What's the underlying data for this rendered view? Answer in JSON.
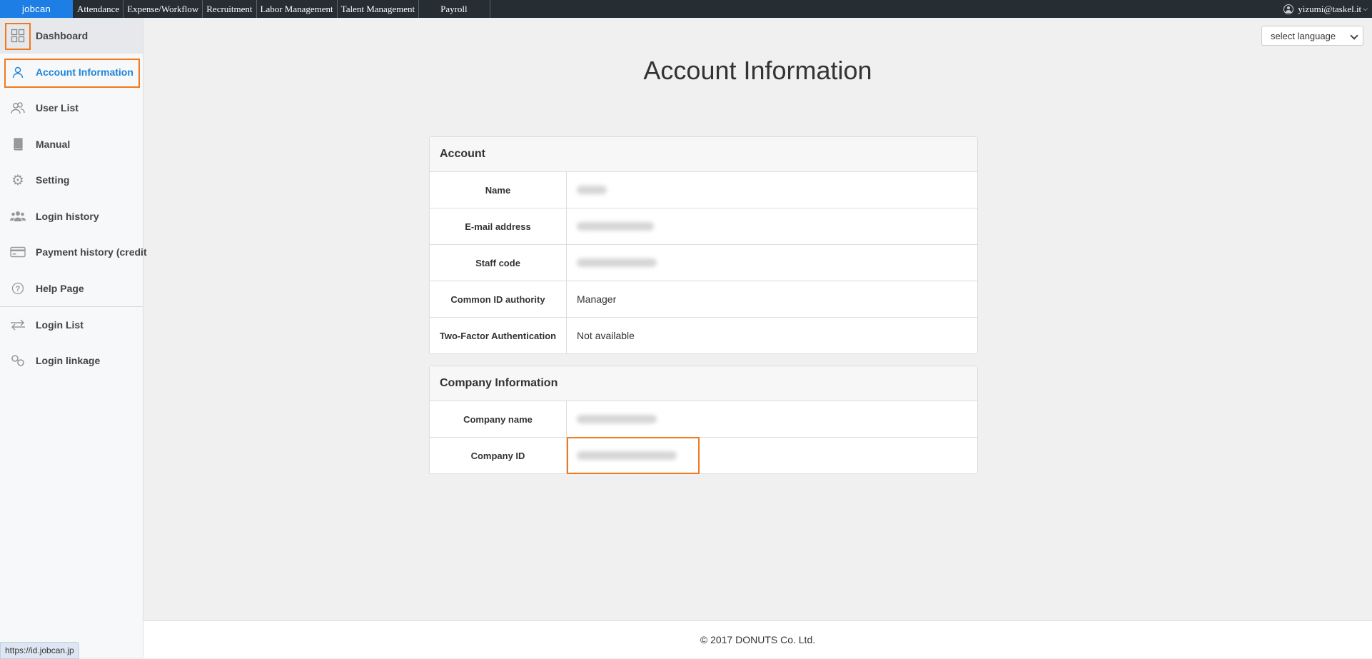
{
  "topbar": {
    "logo": "jobcan",
    "nav": [
      "Attendance",
      "Expense/Workflow",
      "Recruitment",
      "Labor Management",
      "Talent Management",
      "Payroll"
    ],
    "user_email": "yizumi@taskel.it"
  },
  "sidebar": {
    "items": [
      {
        "label": "Dashboard",
        "icon": "grid-icon"
      },
      {
        "label": "Account Information",
        "icon": "user-icon"
      },
      {
        "label": "User List",
        "icon": "users-icon"
      },
      {
        "label": "Manual",
        "icon": "book-icon"
      },
      {
        "label": "Setting",
        "icon": "gear-icon"
      },
      {
        "label": "Login history",
        "icon": "group-icon"
      },
      {
        "label": "Payment history (credit",
        "icon": "credit-card-icon"
      },
      {
        "label": "Help Page",
        "icon": "help-icon"
      },
      {
        "label": "Login List",
        "icon": "swap-icon"
      },
      {
        "label": "Login linkage",
        "icon": "link-icon"
      }
    ],
    "active_item": "Account Information"
  },
  "language_select": {
    "value": "select language"
  },
  "page": {
    "title": "Account Information"
  },
  "account_panel": {
    "title": "Account",
    "rows": [
      {
        "label": "Name",
        "value": ""
      },
      {
        "label": "E-mail address",
        "value": ""
      },
      {
        "label": "Staff code",
        "value": ""
      },
      {
        "label": "Common ID authority",
        "value": "Manager"
      },
      {
        "label": "Two-Factor Authentication",
        "value": "Not available"
      }
    ]
  },
  "company_panel": {
    "title": "Company Information",
    "rows": [
      {
        "label": "Company name",
        "value": ""
      },
      {
        "label": "Company ID",
        "value": ""
      }
    ]
  },
  "footer": {
    "copyright": "© 2017 DONUTS Co. Ltd."
  },
  "status_bar": {
    "url": "https://id.jobcan.jp"
  },
  "colors": {
    "accent": "#1d84d6",
    "highlight": "#f07a1d",
    "topbar": "#262d33",
    "logo_bg": "#1d7fe6"
  }
}
